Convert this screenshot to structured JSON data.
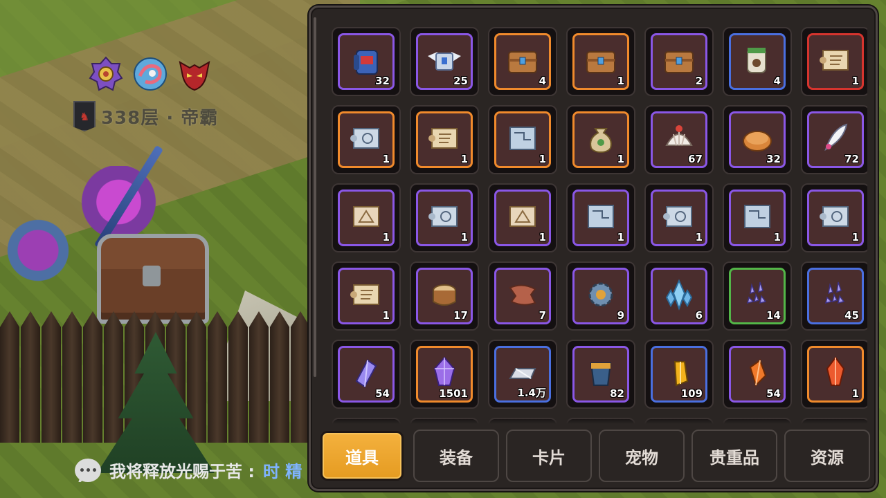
{
  "world": {
    "floor_label": "338层 · 帝霸",
    "badges": [
      "purple-medal-icon",
      "blue-dragon-medal-icon",
      "red-demon-mask-icon"
    ]
  },
  "chat": {
    "icon": "chat-bubble-icon",
    "sender": "我将释放光赐于苦 : ",
    "message": "时 精"
  },
  "inventory": {
    "items": [
      {
        "name": "blue-backpack-icon",
        "rarity": "purple",
        "qty": "32"
      },
      {
        "name": "winged-chest-icon",
        "rarity": "purple",
        "qty": "25"
      },
      {
        "name": "wood-chest-icon",
        "rarity": "orange",
        "qty": "4"
      },
      {
        "name": "wood-chest-icon",
        "rarity": "orange",
        "qty": "1"
      },
      {
        "name": "wood-chest-icon",
        "rarity": "purple",
        "qty": "2"
      },
      {
        "name": "pet-food-jar-icon",
        "rarity": "blue",
        "qty": "4"
      },
      {
        "name": "scroll-icon",
        "rarity": "red",
        "qty": "1"
      },
      {
        "name": "blueprint-scroll-icon",
        "rarity": "orange",
        "qty": "1"
      },
      {
        "name": "scroll-icon",
        "rarity": "orange",
        "qty": "1"
      },
      {
        "name": "blueprint-sheet-icon",
        "rarity": "orange",
        "qty": "1"
      },
      {
        "name": "money-bag-icon",
        "rarity": "orange",
        "qty": "1"
      },
      {
        "name": "seashell-icon",
        "rarity": "purple",
        "qty": "67"
      },
      {
        "name": "mooncake-icon",
        "rarity": "purple",
        "qty": "32"
      },
      {
        "name": "feather-icon",
        "rarity": "purple",
        "qty": "72"
      },
      {
        "name": "map-scroll-icon",
        "rarity": "purple",
        "qty": "1"
      },
      {
        "name": "blueprint-scroll-icon",
        "rarity": "purple",
        "qty": "1"
      },
      {
        "name": "map-scroll-icon",
        "rarity": "purple",
        "qty": "1"
      },
      {
        "name": "blueprint-sheet-icon",
        "rarity": "purple",
        "qty": "1"
      },
      {
        "name": "blueprint-scroll-icon",
        "rarity": "purple",
        "qty": "1"
      },
      {
        "name": "blueprint-sheet-icon",
        "rarity": "purple",
        "qty": "1"
      },
      {
        "name": "blueprint-scroll-icon",
        "rarity": "purple",
        "qty": "1"
      },
      {
        "name": "scroll-icon",
        "rarity": "purple",
        "qty": "1"
      },
      {
        "name": "wood-log-icon",
        "rarity": "purple",
        "qty": "17"
      },
      {
        "name": "leather-icon",
        "rarity": "purple",
        "qty": "7"
      },
      {
        "name": "gear-core-icon",
        "rarity": "purple",
        "qty": "9"
      },
      {
        "name": "ice-crystal-icon",
        "rarity": "purple",
        "qty": "6"
      },
      {
        "name": "crystal-shards-icon",
        "rarity": "green",
        "qty": "14"
      },
      {
        "name": "crystal-shards-icon",
        "rarity": "blue",
        "qty": "45"
      },
      {
        "name": "purple-crystal-icon",
        "rarity": "purple",
        "qty": "54"
      },
      {
        "name": "purple-gem-icon",
        "rarity": "orange",
        "qty": "1501"
      },
      {
        "name": "silver-ingot-icon",
        "rarity": "blue",
        "qty": "1.4万"
      },
      {
        "name": "bucket-icon",
        "rarity": "purple",
        "qty": "82"
      },
      {
        "name": "gold-crystal-icon",
        "rarity": "blue",
        "qty": "109"
      },
      {
        "name": "orange-crystal-icon",
        "rarity": "purple",
        "qty": "54"
      },
      {
        "name": "red-crystal-icon",
        "rarity": "orange",
        "qty": "1"
      }
    ],
    "tabs": [
      {
        "label": "道具",
        "active": true
      },
      {
        "label": "装备",
        "active": false
      },
      {
        "label": "卡片",
        "active": false
      },
      {
        "label": "宠物",
        "active": false
      },
      {
        "label": "贵重品",
        "active": false
      },
      {
        "label": "资源",
        "active": false
      }
    ]
  },
  "colors": {
    "rarity_purple": "#8a57e6",
    "rarity_orange": "#f08a2c",
    "rarity_blue": "#4a6fe0",
    "rarity_red": "#d6342e",
    "rarity_green": "#53b648",
    "tab_active": "#f0a934",
    "panel_bg": "#2a2523"
  }
}
